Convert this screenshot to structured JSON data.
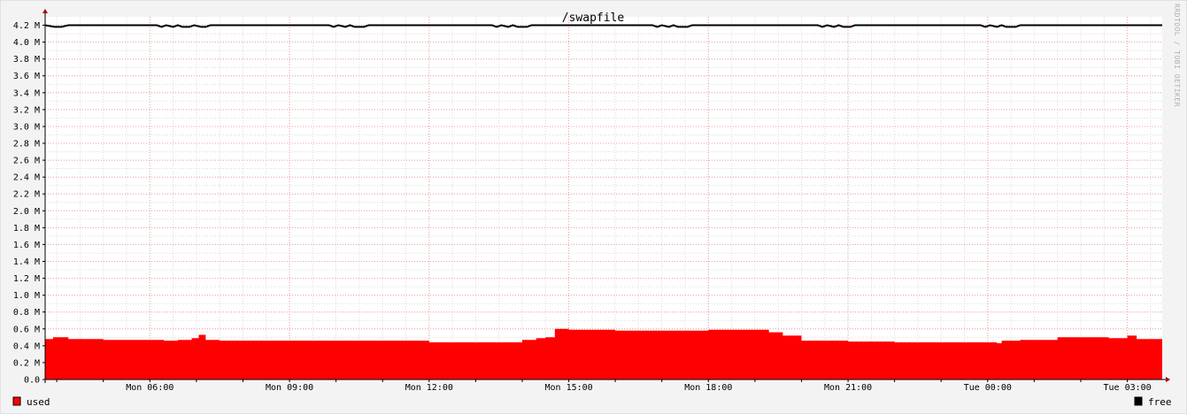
{
  "chart_data": {
    "type": "area",
    "title": "/swapfile",
    "watermark": "RRDTOOL / TOBI OETIKER",
    "y_unit": "M",
    "ylim": [
      0,
      4.3
    ],
    "y_ticks": [
      "0.0",
      "0.2 M",
      "0.4 M",
      "0.6 M",
      "0.8 M",
      "1.0 M",
      "1.2 M",
      "1.4 M",
      "1.6 M",
      "1.8 M",
      "2.0 M",
      "2.2 M",
      "2.4 M",
      "2.6 M",
      "2.8 M",
      "3.0 M",
      "3.2 M",
      "3.4 M",
      "3.6 M",
      "3.8 M",
      "4.0 M",
      "4.2 M"
    ],
    "y_tick_values": [
      0,
      0.2,
      0.4,
      0.6,
      0.8,
      1.0,
      1.2,
      1.4,
      1.6,
      1.8,
      2.0,
      2.2,
      2.4,
      2.6,
      2.8,
      3.0,
      3.2,
      3.4,
      3.6,
      3.8,
      4.0,
      4.2
    ],
    "x_unit": "hours",
    "xlim": [
      3.75,
      27.75
    ],
    "x_ticks": [
      "Mon 06:00",
      "Mon 09:00",
      "Mon 12:00",
      "Mon 15:00",
      "Mon 18:00",
      "Mon 21:00",
      "Tue 00:00",
      "Tue 03:00"
    ],
    "x_tick_values": [
      6,
      9,
      12,
      15,
      18,
      21,
      24,
      27
    ],
    "grid": true,
    "legend_position": "bottom",
    "series": [
      {
        "name": "used",
        "color": "#ff0000",
        "style": "area",
        "x": [
          3.75,
          3.92,
          4.25,
          5.0,
          6.3,
          6.6,
          6.9,
          7.05,
          7.2,
          7.5,
          8.0,
          10.0,
          11.0,
          12.0,
          13.0,
          14.0,
          14.3,
          14.5,
          14.7,
          15.0,
          16.0,
          17.0,
          18.0,
          19.0,
          19.3,
          19.6,
          20.0,
          21.0,
          22.0,
          22.5,
          23.0,
          24.0,
          24.2,
          24.3,
          24.7,
          25.0,
          25.5,
          26.0,
          26.6,
          27.0,
          27.2
        ],
        "values": [
          0.48,
          0.5,
          0.48,
          0.47,
          0.46,
          0.47,
          0.49,
          0.53,
          0.47,
          0.46,
          0.46,
          0.46,
          0.46,
          0.44,
          0.44,
          0.47,
          0.49,
          0.5,
          0.6,
          0.59,
          0.58,
          0.58,
          0.59,
          0.59,
          0.56,
          0.52,
          0.46,
          0.45,
          0.44,
          0.44,
          0.44,
          0.44,
          0.43,
          0.46,
          0.47,
          0.47,
          0.5,
          0.5,
          0.49,
          0.52,
          0.48
        ]
      },
      {
        "name": "free",
        "color": "#000000",
        "style": "line",
        "x": [
          3.75,
          3.95,
          4.1,
          4.25,
          6.15,
          6.25,
          6.35,
          6.5,
          6.6,
          6.7,
          6.85,
          6.95,
          7.1,
          7.2,
          7.3,
          9.85,
          9.95,
          10.05,
          10.2,
          10.3,
          10.4,
          10.6,
          10.7,
          10.8,
          13.35,
          13.45,
          13.55,
          13.7,
          13.8,
          13.9,
          14.1,
          14.2,
          14.3,
          16.8,
          16.9,
          17.0,
          17.15,
          17.25,
          17.35,
          17.55,
          17.65,
          17.75,
          20.35,
          20.45,
          20.55,
          20.7,
          20.8,
          20.9,
          21.05,
          21.15,
          21.25,
          23.85,
          23.95,
          24.05,
          24.2,
          24.3,
          24.4,
          24.6,
          24.7,
          24.8,
          27.75
        ],
        "values": [
          4.2,
          4.18,
          4.18,
          4.2,
          4.2,
          4.18,
          4.2,
          4.18,
          4.2,
          4.18,
          4.18,
          4.2,
          4.18,
          4.18,
          4.2,
          4.2,
          4.18,
          4.2,
          4.18,
          4.2,
          4.18,
          4.18,
          4.2,
          4.2,
          4.2,
          4.18,
          4.2,
          4.18,
          4.2,
          4.18,
          4.18,
          4.2,
          4.2,
          4.2,
          4.18,
          4.2,
          4.18,
          4.2,
          4.18,
          4.18,
          4.2,
          4.2,
          4.2,
          4.18,
          4.2,
          4.18,
          4.2,
          4.18,
          4.18,
          4.2,
          4.2,
          4.2,
          4.18,
          4.2,
          4.18,
          4.2,
          4.18,
          4.18,
          4.2,
          4.2,
          4.2
        ]
      }
    ]
  }
}
